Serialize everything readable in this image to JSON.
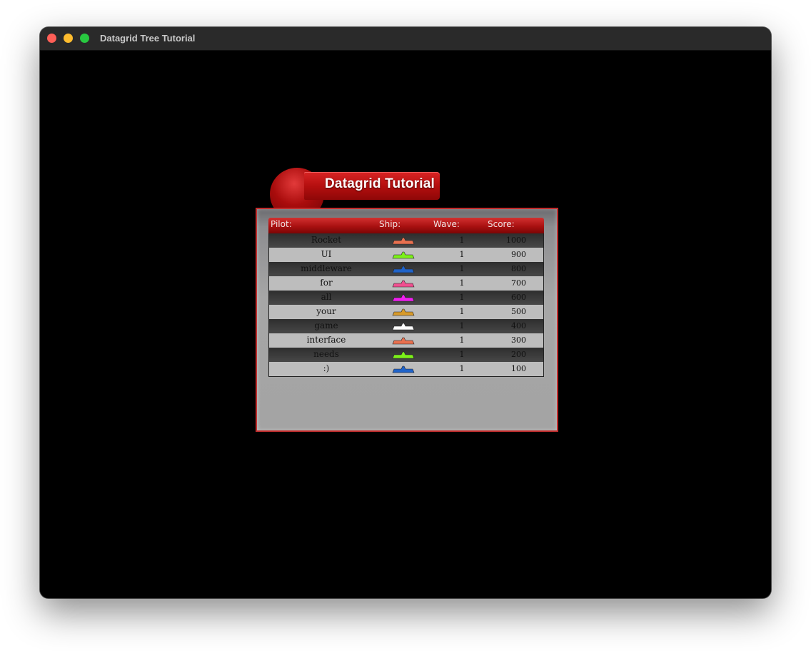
{
  "window": {
    "title": "Datagrid Tree Tutorial"
  },
  "banner": {
    "title": "Datagrid Tutorial"
  },
  "grid": {
    "headers": {
      "pilot": "Pilot:",
      "ship": "Ship:",
      "wave": "Wave:",
      "score": "Score:"
    },
    "rows": [
      {
        "pilot": "Rocket",
        "ship_color": "#e8704f",
        "wave": "1",
        "score": "1000"
      },
      {
        "pilot": "UI",
        "ship_color": "#7cf01a",
        "wave": "1",
        "score": "900"
      },
      {
        "pilot": "middleware",
        "ship_color": "#1f63c9",
        "wave": "1",
        "score": "800"
      },
      {
        "pilot": "for",
        "ship_color": "#f04f8f",
        "wave": "1",
        "score": "700"
      },
      {
        "pilot": "all",
        "ship_color": "#f020f0",
        "wave": "1",
        "score": "600"
      },
      {
        "pilot": "your",
        "ship_color": "#d79a2a",
        "wave": "1",
        "score": "500"
      },
      {
        "pilot": "game",
        "ship_color": "#ffffff",
        "wave": "1",
        "score": "400"
      },
      {
        "pilot": "interface",
        "ship_color": "#e8704f",
        "wave": "1",
        "score": "300"
      },
      {
        "pilot": "needs",
        "ship_color": "#7cf01a",
        "wave": "1",
        "score": "200"
      },
      {
        "pilot": ":)",
        "ship_color": "#1f63c9",
        "wave": "1",
        "score": "100"
      }
    ]
  }
}
